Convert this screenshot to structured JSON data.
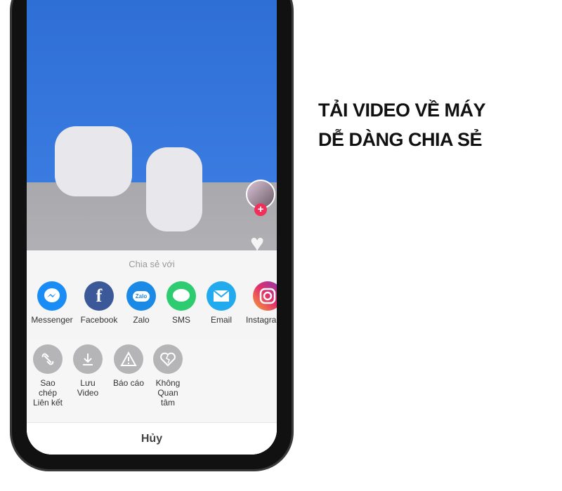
{
  "headline": {
    "line1": "TẢI VIDEO VỀ MÁY",
    "line2": "DỄ DÀNG CHIA SẺ"
  },
  "share_sheet": {
    "title": "Chia sẻ với",
    "apps": [
      {
        "label": "Messenger",
        "icon": "messenger-icon",
        "color": "#1a8cf5"
      },
      {
        "label": "Facebook",
        "icon": "facebook-icon",
        "color": "#3b5998"
      },
      {
        "label": "Zalo",
        "icon": "zalo-icon",
        "icon_text": "Zalo",
        "color": "#1b8ae6"
      },
      {
        "label": "SMS",
        "icon": "sms-icon",
        "color": "#2ecc71"
      },
      {
        "label": "Email",
        "icon": "email-icon",
        "color": "#22aaee"
      },
      {
        "label": "Instagram",
        "icon": "instagram-icon",
        "color": "#d6297a"
      }
    ],
    "actions": [
      {
        "label": "Sao chép Liên kết",
        "icon": "link-icon"
      },
      {
        "label": "Lưu Video",
        "icon": "download-icon"
      },
      {
        "label": "Báo cáo",
        "icon": "warning-icon"
      },
      {
        "label": "Không Quan tâm",
        "icon": "broken-heart-icon"
      }
    ],
    "cancel": "Hủy"
  },
  "side": {
    "plus": "+"
  }
}
